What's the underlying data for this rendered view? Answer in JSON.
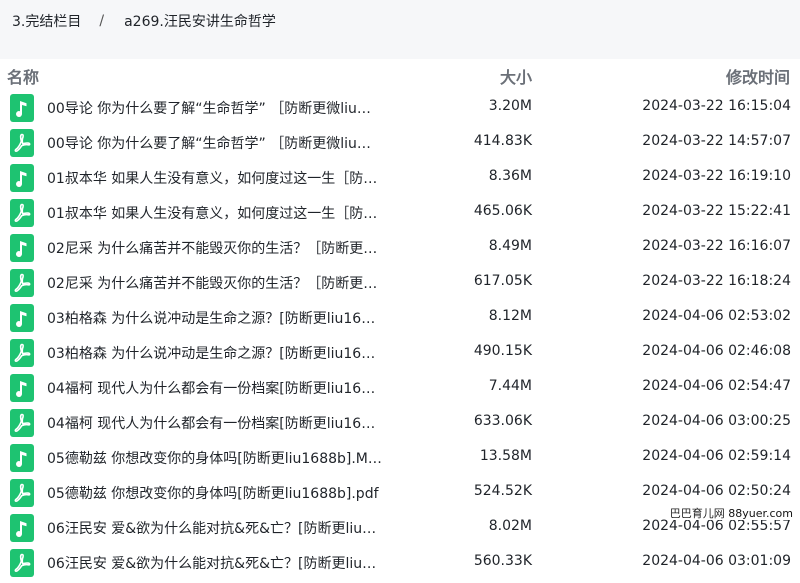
{
  "breadcrumb": {
    "parent": "3.完结栏目",
    "separator": "/",
    "current": "a269.汪民安讲生命哲学"
  },
  "columns": {
    "name": "名称",
    "size": "大小",
    "modified": "修改时间"
  },
  "colors": {
    "icon_green": "#1ec371",
    "pdf_icon": "pdf-icon",
    "audio_icon": "music-note-icon"
  },
  "files": [
    {
      "type": "audio",
      "name": "00导论 你为什么要了解“生命哲学” ［防断更微liu…",
      "size": "3.20M",
      "modified": "2024-03-22 16:15:04"
    },
    {
      "type": "pdf",
      "name": "00导论 你为什么要了解“生命哲学” ［防断更微liu…",
      "size": "414.83K",
      "modified": "2024-03-22 14:57:07"
    },
    {
      "type": "audio",
      "name": "01叔本华 如果人生没有意义，如何度过这一生［防…",
      "size": "8.36M",
      "modified": "2024-03-22 16:19:10"
    },
    {
      "type": "pdf",
      "name": "01叔本华 如果人生没有意义，如何度过这一生［防…",
      "size": "465.06K",
      "modified": "2024-03-22 15:22:41"
    },
    {
      "type": "audio",
      "name": "02尼采 为什么痛苦并不能毁灭你的生活？［防断更…",
      "size": "8.49M",
      "modified": "2024-03-22 16:16:07"
    },
    {
      "type": "pdf",
      "name": "02尼采 为什么痛苦并不能毁灭你的生活？［防断更…",
      "size": "617.05K",
      "modified": "2024-03-22 16:18:24"
    },
    {
      "type": "audio",
      "name": "03柏格森 为什么说冲动是生命之源？[防断更liu16…",
      "size": "8.12M",
      "modified": "2024-04-06 02:53:02"
    },
    {
      "type": "pdf",
      "name": "03柏格森 为什么说冲动是生命之源？[防断更liu16…",
      "size": "490.15K",
      "modified": "2024-04-06 02:46:08"
    },
    {
      "type": "audio",
      "name": "04福柯 现代人为什么都会有一份档案[防断更liu16…",
      "size": "7.44M",
      "modified": "2024-04-06 02:54:47"
    },
    {
      "type": "pdf",
      "name": "04福柯 现代人为什么都会有一份档案[防断更liu16…",
      "size": "633.06K",
      "modified": "2024-04-06 03:00:25"
    },
    {
      "type": "audio",
      "name": "05德勒兹 你想改变你的身体吗[防断更liu1688b].M…",
      "size": "13.58M",
      "modified": "2024-04-06 02:59:14"
    },
    {
      "type": "pdf",
      "name": "05德勒兹 你想改变你的身体吗[防断更liu1688b].pdf",
      "size": "524.52K",
      "modified": "2024-04-06 02:50:24"
    },
    {
      "type": "audio",
      "name": "06汪民安 爱&欲为什么能对抗&死&亡？[防断更liu…",
      "size": "8.02M",
      "modified": "2024-04-06 02:55:57"
    },
    {
      "type": "pdf",
      "name": "06汪民安 爱&欲为什么能对抗&死&亡？[防断更liu…",
      "size": "560.33K",
      "modified": "2024-04-06 03:01:09"
    }
  ],
  "watermark": {
    "text": "巴巴育儿网",
    "site": "88yuer.com"
  }
}
